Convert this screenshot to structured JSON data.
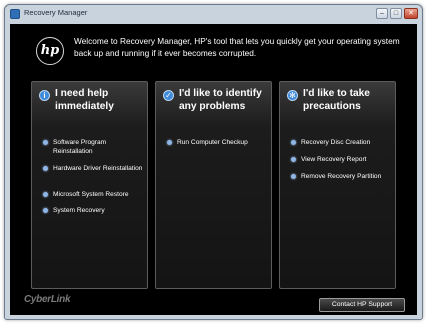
{
  "window": {
    "title": "Recovery Manager",
    "controls": {
      "minimize": "–",
      "maximize": "□",
      "close": "✕"
    }
  },
  "header": {
    "logo": "hp",
    "welcome": "Welcome to Recovery Manager, HP's tool that lets you quickly get your operating system back up and running if it ever becomes corrupted."
  },
  "panels": [
    {
      "icon": "info-icon",
      "icon_glyph": "i",
      "title": "I need help immediately",
      "items": [
        "Software Program Reinstallation",
        "Hardware Driver Reinstallation",
        "Microsoft System Restore",
        "System Recovery"
      ]
    },
    {
      "icon": "checkmark-icon",
      "icon_glyph": "✓",
      "title": "I'd like to identify any problems",
      "items": [
        "Run Computer Checkup"
      ]
    },
    {
      "icon": "gear-icon",
      "icon_glyph": "✻",
      "title": "I'd like to take precautions",
      "items": [
        "Recovery Disc Creation",
        "View Recovery Report",
        "Remove Recovery Partition"
      ]
    }
  ],
  "footer": {
    "brand": "CyberLink",
    "support_button": "Contact HP Support"
  },
  "colors": {
    "accent": "#3f8ad8",
    "background": "#000000",
    "panel_border": "#5c5c5c"
  }
}
